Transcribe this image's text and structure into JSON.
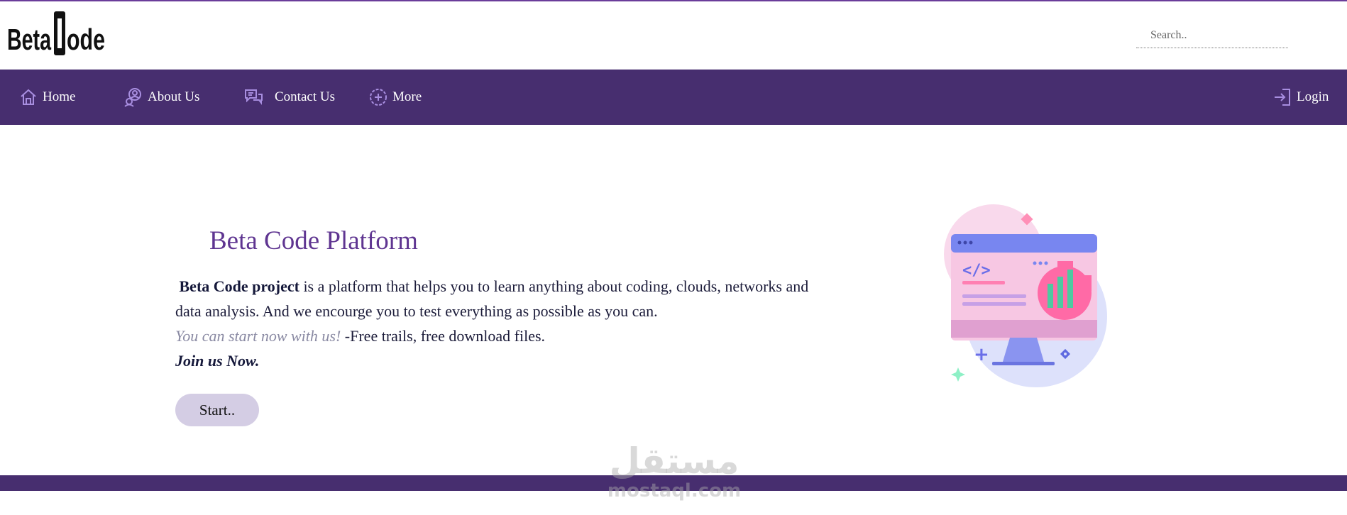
{
  "brand": {
    "logo_text": "BetaCode"
  },
  "search": {
    "placeholder": "Search.."
  },
  "nav": {
    "items": [
      {
        "label": "Home",
        "icon": "home-icon"
      },
      {
        "label": "About Us",
        "icon": "user-icon"
      },
      {
        "label": "Contact Us",
        "icon": "chat-icon"
      },
      {
        "label": "More",
        "icon": "plus-circle-icon"
      }
    ],
    "login": {
      "label": "Login",
      "icon": "login-icon"
    }
  },
  "hero": {
    "title": "Beta Code Platform",
    "bold_lead": "Beta Code project",
    "text_1": " is a platform that helps you to learn anything about coding, clouds, networks and data analysis. And we encourge you to test everything as possible as you can.",
    "muted": "You can start now with us!",
    "text_2": " -Free trails, free download files.",
    "join": "Join us Now.",
    "button": "Start.."
  },
  "watermark": {
    "arabic": "مستقل",
    "latin": "mostaql.com"
  },
  "colors": {
    "nav_bg": "#472e6f",
    "title": "#5f3591",
    "button_bg": "#d4cde4",
    "muted_text": "#8a8aa3"
  }
}
